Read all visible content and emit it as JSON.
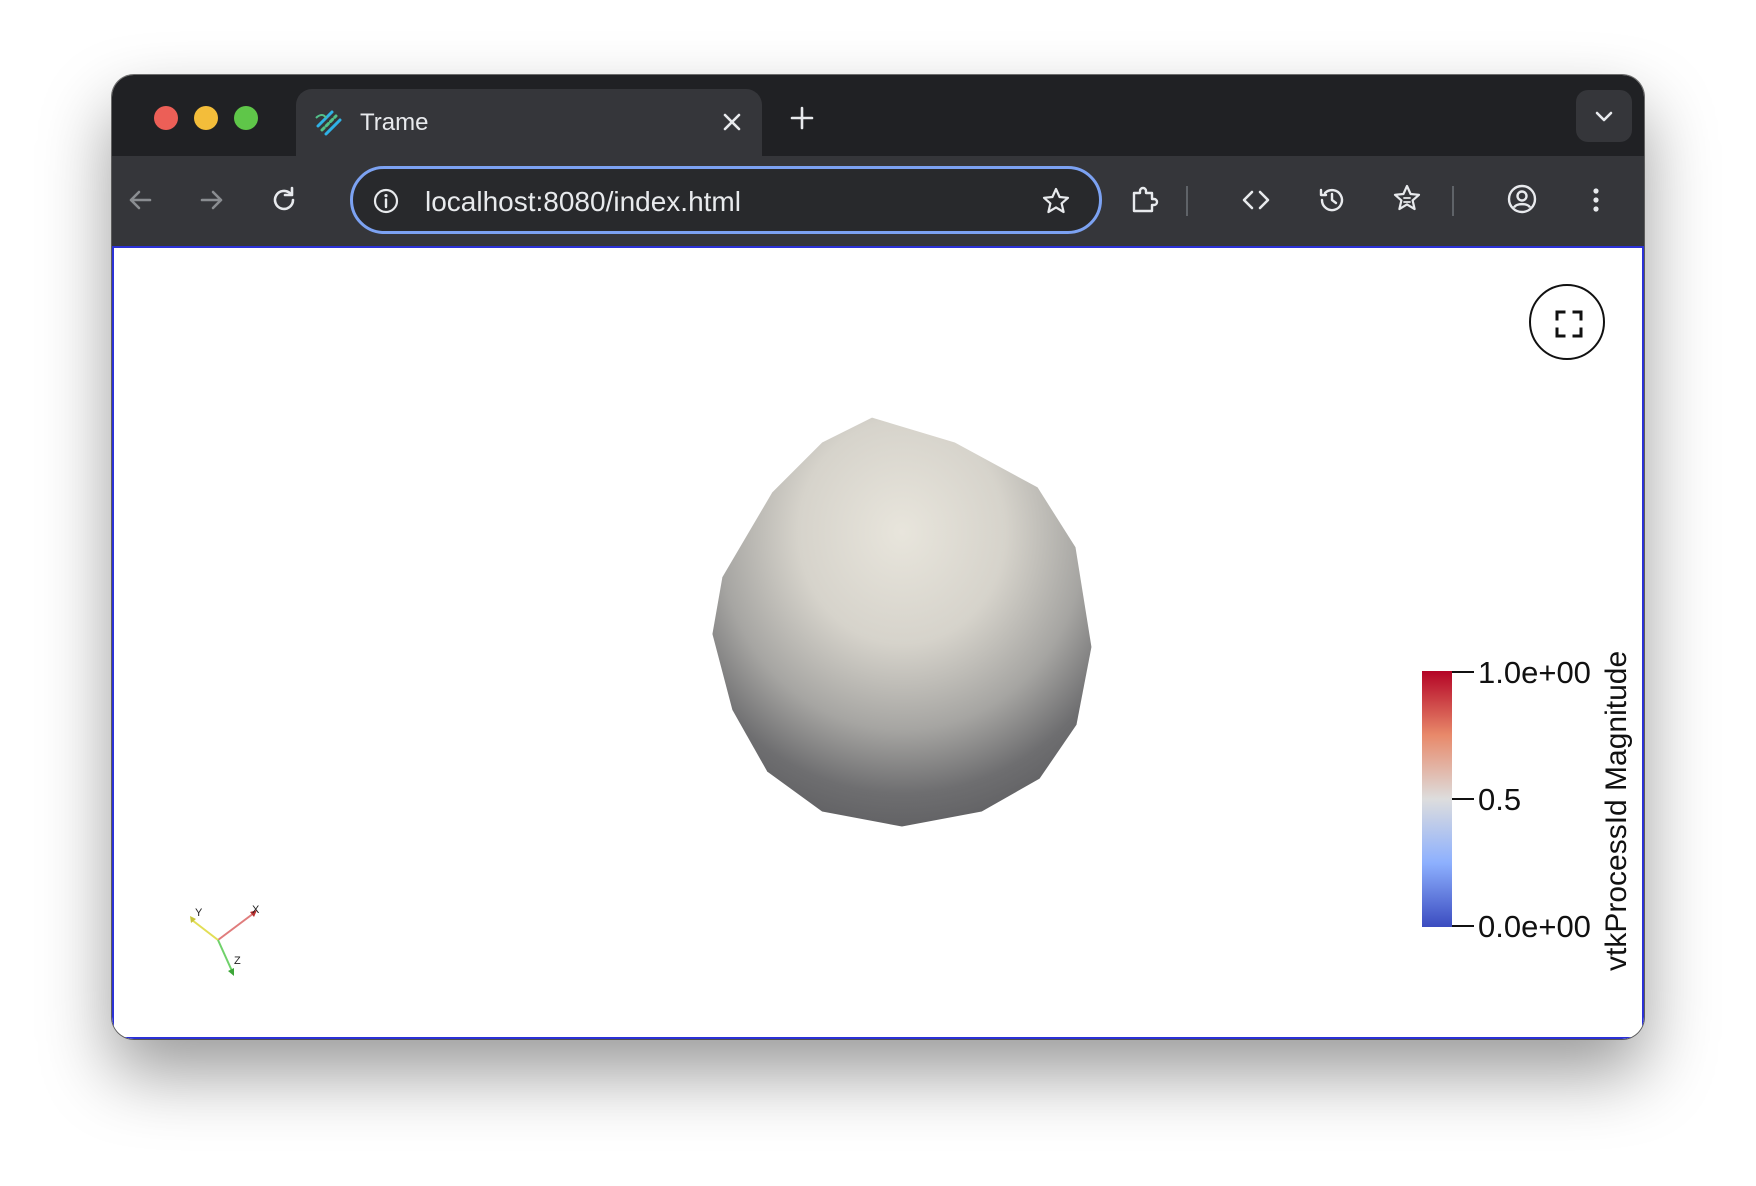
{
  "browser": {
    "tab": {
      "title": "Trame"
    },
    "address_bar": {
      "url": "localhost:8080/index.html"
    },
    "colors": {
      "focus_ring": "#7ca2f2",
      "frame": "#202124",
      "toolbar": "#35363a"
    }
  },
  "viewer": {
    "scalar_bar": {
      "title": "vtkProcessId Magnitude",
      "labels": [
        "1.0e+00",
        "0.5",
        "0.0e+00"
      ],
      "colors": {
        "max": "#b40426",
        "mid": "#dddddd",
        "min": "#3b4cc0"
      }
    },
    "axes": {
      "x_label": "X",
      "y_label": "Y",
      "z_label": "Z"
    },
    "icons": {
      "fullscreen": "fullscreen-icon"
    }
  }
}
